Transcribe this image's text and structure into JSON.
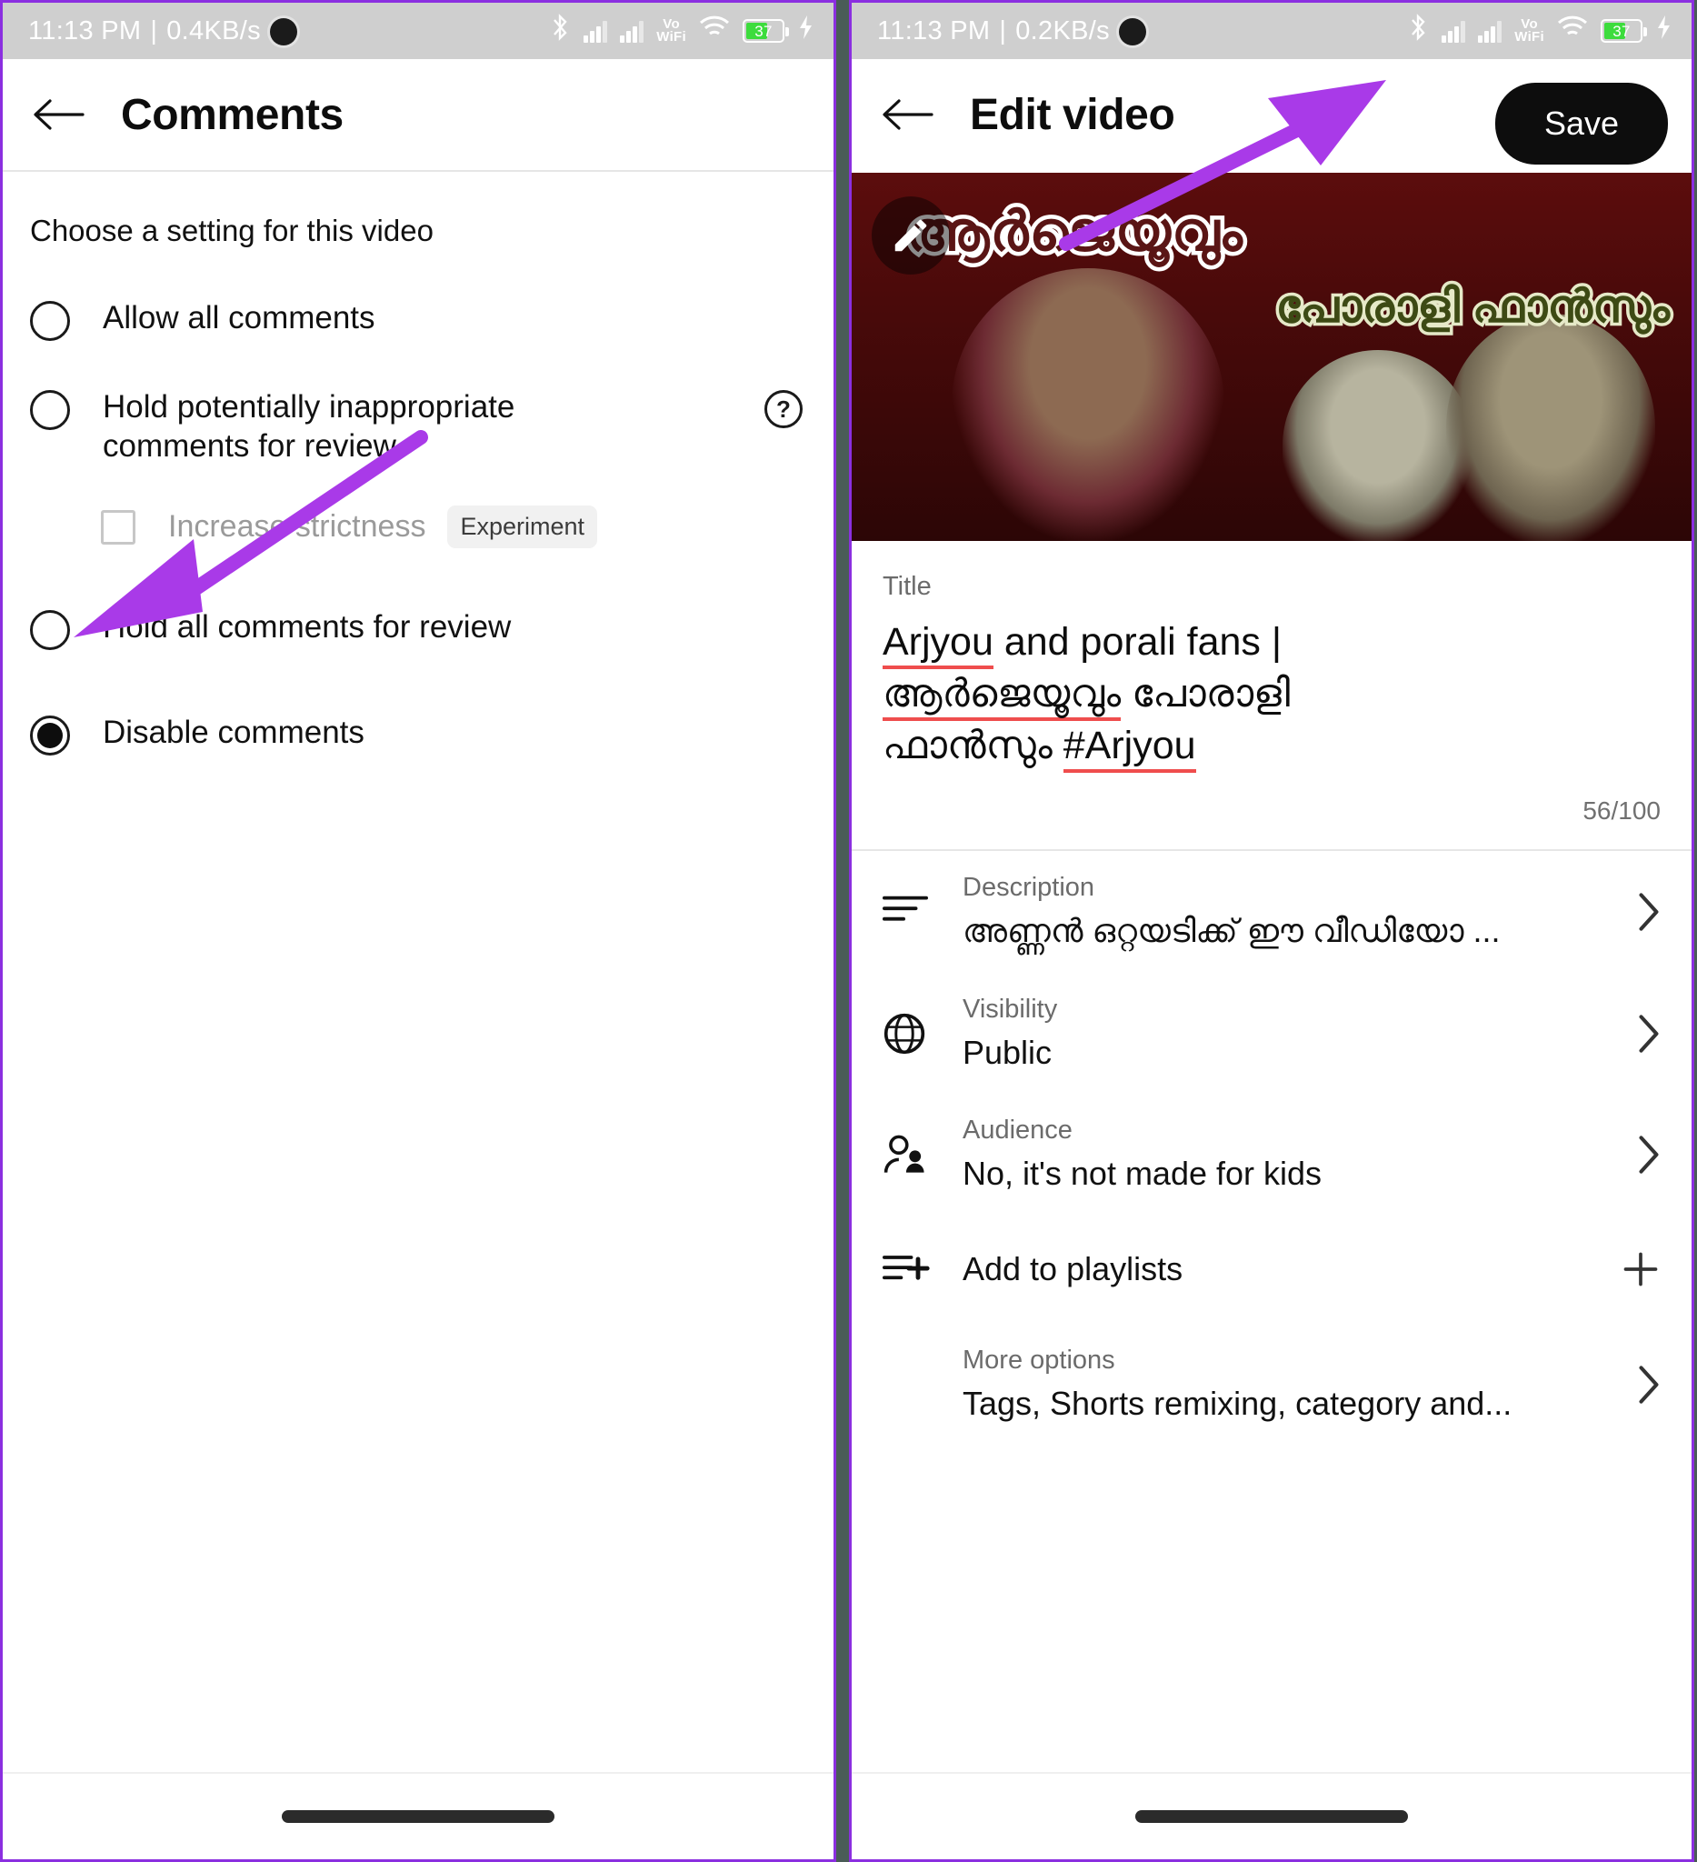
{
  "left": {
    "status_bar": {
      "time": "11:13 PM",
      "separator": "|",
      "net_speed": "0.4KB/s",
      "battery_percent": "37"
    },
    "app_bar": {
      "title": "Comments",
      "back_icon": "arrow-left-icon"
    },
    "section_heading": "Choose a setting for this video",
    "options": [
      {
        "label": "Allow all comments",
        "selected": false
      },
      {
        "label": "Hold potentially inappropriate comments for review",
        "selected": false,
        "has_help": true
      },
      {
        "label": "Hold all comments for review",
        "selected": false
      },
      {
        "label": "Disable comments",
        "selected": true
      }
    ],
    "sub_option": {
      "label": "Increase strictness",
      "badge": "Experiment",
      "checked": false
    }
  },
  "right": {
    "status_bar": {
      "time": "11:13 PM",
      "separator": "|",
      "net_speed": "0.2KB/s",
      "battery_percent": "37"
    },
    "app_bar": {
      "title": "Edit video",
      "back_icon": "arrow-left-icon",
      "save_label": "Save"
    },
    "thumbnail": {
      "edit_icon": "pencil-icon",
      "overlay_text_top": "ആർജെയൂവും",
      "overlay_text_right": "പോരാളി ഫാൻസും"
    },
    "title_field": {
      "label": "Title",
      "line1": "Arjyou",
      "line1_rest": " and porali fans |",
      "line2": "ആർജെയൂവും",
      "line2_rest": " പോരാളി",
      "line3": "ഫാൻസും ",
      "line3_tag": "#Arjyou",
      "counter": "56/100"
    },
    "rows": [
      {
        "icon": "description-lines-icon",
        "label": "Description",
        "value": "അണ്ണൻ ഒറ്റയടിക്ക് ഈ വീഡിയോ ...",
        "trailing": "chevron-right-icon"
      },
      {
        "icon": "globe-icon",
        "label": "Visibility",
        "value": "Public",
        "trailing": "chevron-right-icon"
      },
      {
        "icon": "audience-people-icon",
        "label": "Audience",
        "value": "No, it's not made for kids",
        "trailing": "chevron-right-icon"
      },
      {
        "icon": "playlist-add-icon",
        "label": "",
        "value": "Add to playlists",
        "trailing": "plus-icon"
      },
      {
        "icon": "",
        "label": "More options",
        "value": "Tags, Shorts remixing, category and...",
        "trailing": "chevron-right-icon"
      }
    ]
  },
  "annotations": {
    "accent_color": "#A93AE8",
    "arrow_to_disable_comments": "arrow-annotation-icon",
    "arrow_to_save": "arrow-annotation-icon"
  }
}
